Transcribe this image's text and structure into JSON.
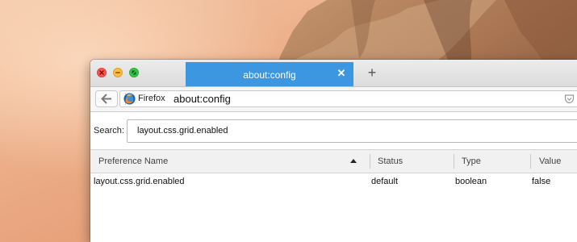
{
  "tab": {
    "title": "about:config"
  },
  "navbar": {
    "identity_label": "Firefox",
    "url": "about:config"
  },
  "search": {
    "label": "Search:",
    "value": "layout.css.grid.enabled"
  },
  "table": {
    "columns": [
      "Preference Name",
      "Status",
      "Type",
      "Value"
    ],
    "sort_column": "Preference Name",
    "rows": [
      {
        "name": "layout.css.grid.enabled",
        "status": "default",
        "type": "boolean",
        "value": "false"
      }
    ]
  },
  "colors": {
    "active_tab": "#3d97e0",
    "close": "#fc5753",
    "minimize": "#fdbc40",
    "maximize": "#34c84a"
  },
  "icons": [
    "close-icon",
    "minimize-icon",
    "maximize-icon",
    "tab-close-icon",
    "new-tab-icon",
    "back-arrow-icon",
    "firefox-logo-icon",
    "pocket-icon",
    "sort-ascending-icon"
  ]
}
